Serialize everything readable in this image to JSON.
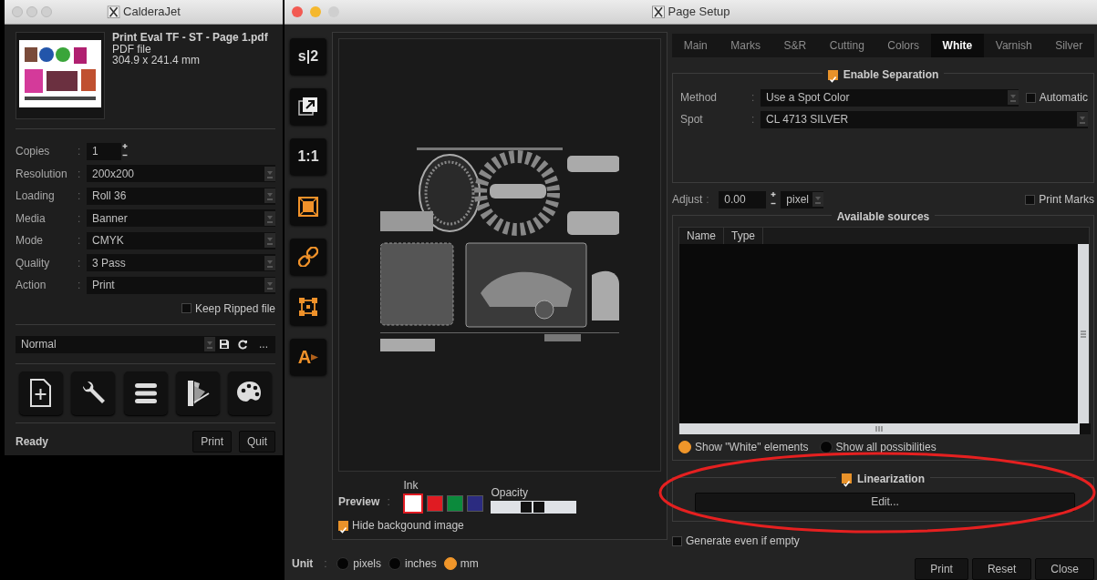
{
  "caldera_window": {
    "title": "CalderaJet",
    "file": {
      "name": "Print Eval TF - ST - Page 1.pdf",
      "type": "PDF file",
      "size": "304.9 x 241.4 mm"
    },
    "copies": {
      "label": "Copies",
      "separator": ":",
      "value": "1"
    },
    "fields": [
      {
        "label": "Resolution",
        "separator": ":",
        "value": "200x200"
      },
      {
        "label": "Loading",
        "separator": ":",
        "value": "Roll 36"
      },
      {
        "label": "Media",
        "separator": ":",
        "value": "Banner"
      },
      {
        "label": "Mode",
        "separator": ":",
        "value": "CMYK"
      },
      {
        "label": "Quality",
        "separator": ":",
        "value": "3 Pass"
      },
      {
        "label": "Action",
        "separator": ":",
        "value": "Print"
      }
    ],
    "keep_ripped": {
      "label": "Keep Ripped file",
      "checked": false
    },
    "preset": {
      "value": "Normal",
      "more": "..."
    },
    "status": "Ready",
    "buttons": [
      "Print",
      "Quit"
    ]
  },
  "page_setup": {
    "title": "Page Setup",
    "toolbar": [
      {
        "kind": "text",
        "text": "s|2"
      },
      {
        "kind": "export"
      },
      {
        "kind": "text",
        "text": "1:1"
      },
      {
        "kind": "fit"
      },
      {
        "kind": "link"
      },
      {
        "kind": "nodes"
      },
      {
        "kind": "letter",
        "text": "A"
      }
    ],
    "preview": {
      "label": "Preview",
      "separator": ":",
      "ink_label": "Ink",
      "opacity_label": "Opacity",
      "inks": [
        {
          "color": "#ffffff",
          "selected": true
        },
        {
          "color": "#e01b22",
          "selected": false
        },
        {
          "color": "#0b8a3c",
          "selected": false
        },
        {
          "color": "#2b2b80",
          "selected": false
        }
      ],
      "hide_background": {
        "label": "Hide backgound image",
        "checked": true
      }
    },
    "unit": {
      "label": "Unit",
      "separator": ":",
      "options": [
        {
          "label": "pixels",
          "selected": false
        },
        {
          "label": "inches",
          "selected": false
        },
        {
          "label": "mm",
          "selected": true
        }
      ]
    },
    "tabs": [
      {
        "label": "Main",
        "selected": false
      },
      {
        "label": "Marks",
        "selected": false
      },
      {
        "label": "S&R",
        "selected": false
      },
      {
        "label": "Cutting",
        "selected": false
      },
      {
        "label": "Colors",
        "selected": false
      },
      {
        "label": "White",
        "selected": true
      },
      {
        "label": "Varnish",
        "selected": false
      },
      {
        "label": "Silver",
        "selected": false
      }
    ],
    "separation": {
      "label": "Enable Separation",
      "checked": true,
      "method": {
        "label": "Method",
        "separator": ":",
        "value": "Use a Spot Color"
      },
      "automatic": {
        "label": "Automatic",
        "checked": false
      },
      "spot": {
        "label": "Spot",
        "separator": ":",
        "value": "CL 4713 SILVER"
      }
    },
    "adjust": {
      "label": "Adjust",
      "separator": ":",
      "value": "0.00",
      "unit": "pixel"
    },
    "print_marks": {
      "label": "Print Marks",
      "checked": false
    },
    "sources": {
      "title": "Available sources",
      "columns": [
        "Name",
        "Type"
      ],
      "filters": [
        {
          "label": "Show \"White\" elements",
          "selected": true
        },
        {
          "label": "Show all possibilities",
          "selected": false
        }
      ]
    },
    "linearization": {
      "label": "Linearization",
      "checked": true,
      "button": "Edit..."
    },
    "generate_empty": {
      "label": "Generate even if empty",
      "checked": false
    },
    "buttons": [
      "Print",
      "Reset",
      "Close"
    ]
  },
  "annotations": [
    {
      "kind": "ellipse"
    }
  ]
}
